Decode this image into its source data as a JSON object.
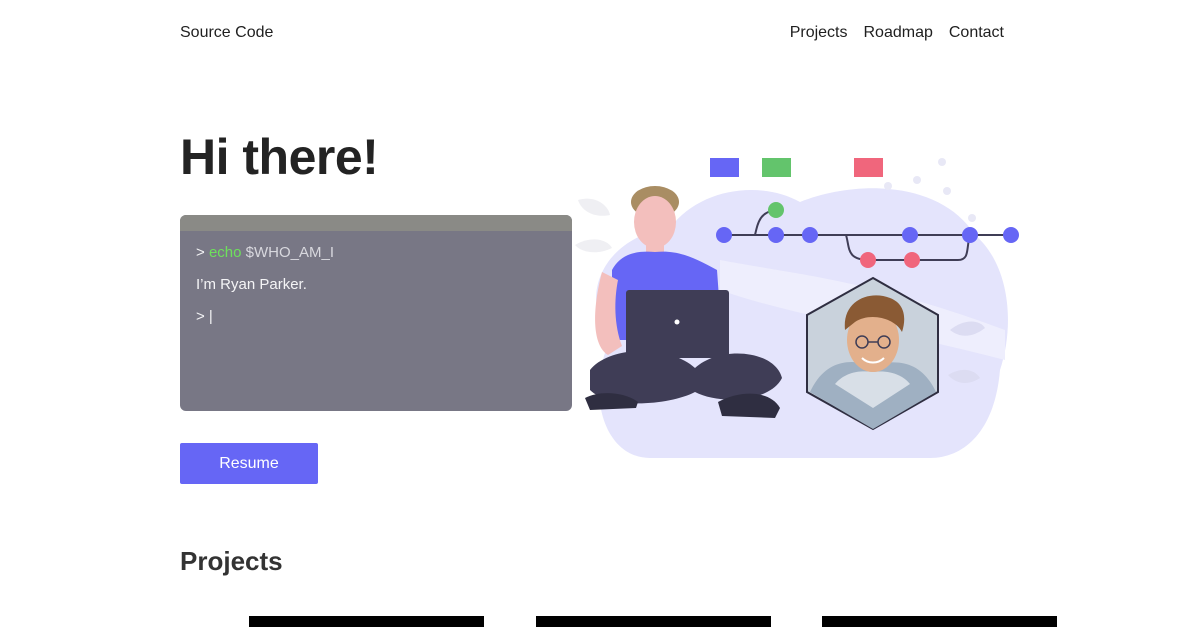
{
  "nav": {
    "brand": "Source Code",
    "links": [
      "Projects",
      "Roadmap",
      "Contact"
    ]
  },
  "hero": {
    "title": "Hi there!",
    "terminal": {
      "prompt": ">",
      "command": "echo",
      "variable": "$WHO_AM_I",
      "output": "I’m Ryan Parker.",
      "cursor_line": "> |"
    },
    "resume_label": "Resume"
  },
  "projects": {
    "title": "Projects",
    "card_count": 3
  },
  "colors": {
    "accent": "#6666f5",
    "terminal_bg": "#787785",
    "command_green": "#6ee05c",
    "git_green": "#63c46c",
    "git_red": "#f0667c",
    "illustration_blob": "#e4e4fc"
  }
}
